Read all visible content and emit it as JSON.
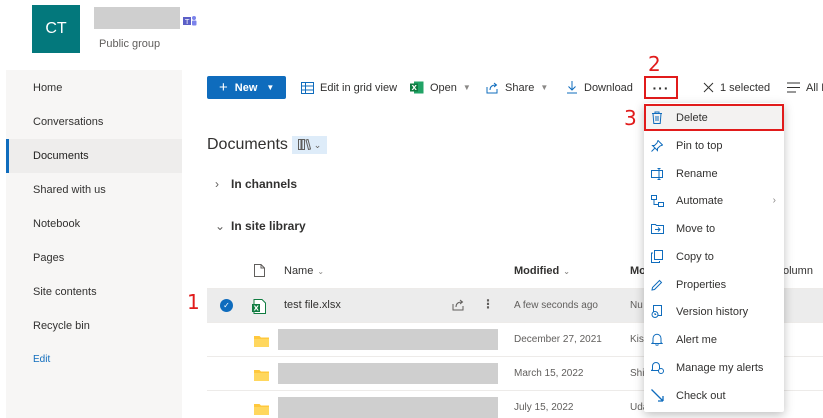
{
  "site": {
    "avatar_initials": "CT",
    "group_type": "Public group"
  },
  "sidebar": {
    "items": [
      {
        "label": "Home"
      },
      {
        "label": "Conversations"
      },
      {
        "label": "Documents"
      },
      {
        "label": "Shared with us"
      },
      {
        "label": "Notebook"
      },
      {
        "label": "Pages"
      },
      {
        "label": "Site contents"
      },
      {
        "label": "Recycle bin"
      }
    ],
    "edit_label": "Edit"
  },
  "toolbar": {
    "new_label": "New",
    "edit_grid_label": "Edit in grid view",
    "open_label": "Open",
    "share_label": "Share",
    "download_label": "Download",
    "more_label": "···",
    "selected_label": "1 selected",
    "all_label": "All D"
  },
  "steps": {
    "one": "1",
    "two": "2",
    "three": "3"
  },
  "documents": {
    "title": "Documents",
    "sections": {
      "channels": "In channels",
      "site_library": "In site library"
    },
    "columns": {
      "name": "Name",
      "modified": "Modified",
      "modified_by": "Mo",
      "extra": "olumn"
    },
    "rows": [
      {
        "name": "test file.xlsx",
        "modified": "A few seconds ago",
        "modified_by": "Nu",
        "selected": true
      },
      {
        "name": "",
        "modified": "December 27, 2021",
        "modified_by": "Kish"
      },
      {
        "name": "",
        "modified": "March 15, 2022",
        "modified_by": "Shir"
      },
      {
        "name": "",
        "modified": "July 15, 2022",
        "modified_by": "Uda"
      }
    ]
  },
  "context_menu": {
    "items": [
      {
        "label": "Delete",
        "icon": "trash-icon"
      },
      {
        "label": "Pin to top",
        "icon": "pin-icon"
      },
      {
        "label": "Rename",
        "icon": "rename-icon"
      },
      {
        "label": "Automate",
        "icon": "automate-icon"
      },
      {
        "label": "Move to",
        "icon": "move-icon"
      },
      {
        "label": "Copy to",
        "icon": "copy-icon"
      },
      {
        "label": "Properties",
        "icon": "pencil-icon"
      },
      {
        "label": "Version history",
        "icon": "history-icon"
      },
      {
        "label": "Alert me",
        "icon": "bell-icon"
      },
      {
        "label": "Manage my alerts",
        "icon": "manage-alerts-icon"
      },
      {
        "label": "Check out",
        "icon": "checkout-icon"
      }
    ]
  },
  "colors": {
    "accent": "#0f6cbd",
    "annotation": "#e11b1b",
    "site_avatar": "#03787c",
    "folder": "#ffc83d",
    "excel": "#107c41"
  }
}
